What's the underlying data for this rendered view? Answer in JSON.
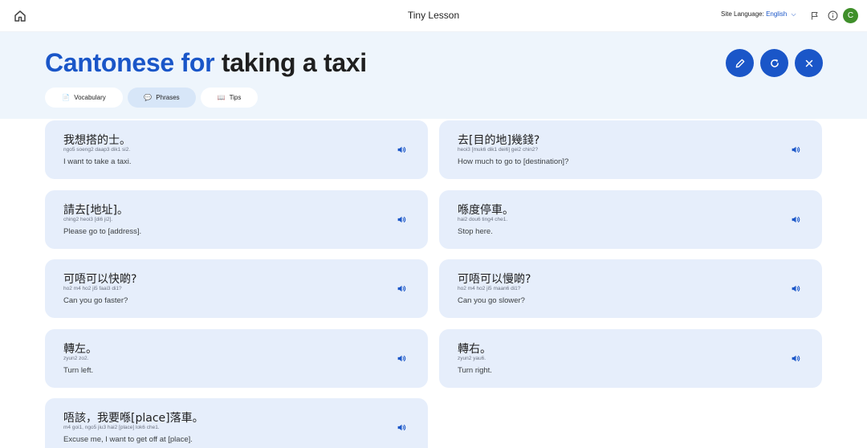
{
  "topbar": {
    "title": "Tiny Lesson",
    "site_language_label": "Site Language:",
    "site_language_value": "English",
    "avatar_initial": "C"
  },
  "header": {
    "title_part1": "Cantonese for",
    "title_part2": "taking a taxi",
    "tabs": [
      {
        "label": "Vocabulary",
        "icon": "📄",
        "active": false
      },
      {
        "label": "Phrases",
        "icon": "💬",
        "active": true
      },
      {
        "label": "Tips",
        "icon": "📖",
        "active": false
      }
    ],
    "action_icons": [
      "edit-icon",
      "refresh-icon",
      "close-icon"
    ]
  },
  "colors": {
    "accent": "#1a56c8",
    "band_bg": "#eef5fc",
    "card_bg": "#e6eefb",
    "avatar": "#3f8f2a"
  },
  "phrases": [
    {
      "zh": "我想搭的士。",
      "romanization": "ngo5 soeng2 daap3 dik1 si2.",
      "en": "I want to take a taxi."
    },
    {
      "zh": "去[目的地]幾錢?",
      "romanization": "heoi3 [muk6 dik1 dei6] gei2 chin2?",
      "en": "How much to go to [destination]?"
    },
    {
      "zh": "請去[地址]。",
      "romanization": "ching2 heoi3 [di6 ji2].",
      "en": "Please go to [address]."
    },
    {
      "zh": "喺度停車。",
      "romanization": "hai2 dou6 ting4 che1.",
      "en": "Stop here."
    },
    {
      "zh": "可唔可以快啲?",
      "romanization": "ho2 m4 ho2 ji5 faai3 di1?",
      "en": "Can you go faster?"
    },
    {
      "zh": "可唔可以慢啲?",
      "romanization": "ho2 m4 ho2 ji5 maan6 di1?",
      "en": "Can you go slower?"
    },
    {
      "zh": "轉左。",
      "romanization": "zyun2 zo2.",
      "en": "Turn left."
    },
    {
      "zh": "轉右。",
      "romanization": "zyun2 yau6.",
      "en": "Turn right."
    },
    {
      "zh": "唔該，我要喺[place]落車。",
      "romanization": "m4 goi1, ngo5 jiu3 hai2 [place] lok6 che1.",
      "en": "Excuse me, I want to get off at [place]."
    }
  ]
}
